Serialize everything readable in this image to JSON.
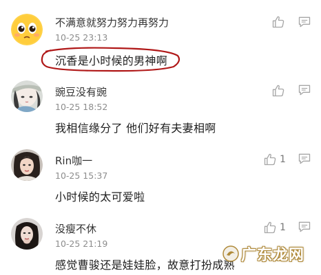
{
  "comments": [
    {
      "username": "不满意就努力努力再努力",
      "timestamp": "10-25 23:13",
      "text": "沉香是小时候的男神啊",
      "likes": ""
    },
    {
      "username": "豌豆没有豌",
      "timestamp": "10-25 18:52",
      "text": "我相信缘分了  他们好有夫妻相啊",
      "likes": ""
    },
    {
      "username": "Rin咖一",
      "timestamp": "10-25 15:37",
      "text": "小时候的太可爱啦",
      "likes": "1"
    },
    {
      "username": "没瘦不休",
      "timestamp": "10-25 21:19",
      "text": "感觉曹骏还是娃娃脸，故意打扮成熟",
      "likes": "1"
    }
  ],
  "watermark": {
    "text": "广东龙网"
  },
  "colors": {
    "highlight": "#b01818",
    "icon": "#a6a6a6",
    "watermark_outline": "#b08a3a"
  },
  "icons": {
    "like": "thumbs-up-icon",
    "reply": "comment-bubble-icon"
  }
}
